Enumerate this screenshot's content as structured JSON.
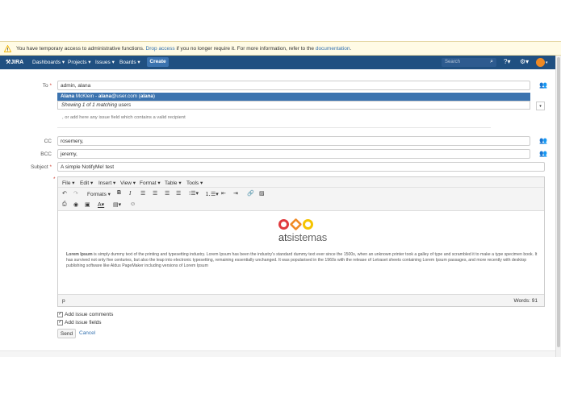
{
  "banner": {
    "text_before": "You have temporary access to administrative functions.",
    "drop_access": "Drop access",
    "text_middle": "if you no longer require it. For more information, refer to the",
    "documentation": "documentation",
    "text_end": ".",
    "icon": "warning-icon"
  },
  "nav": {
    "logo": "JIRA",
    "items": [
      "Dashboards ▾",
      "Projects ▾",
      "Issues ▾",
      "Boards ▾"
    ],
    "create": "Create",
    "search_placeholder": "Search",
    "icons": [
      "search-icon",
      "help-icon",
      "gear-icon",
      "avatar"
    ]
  },
  "form": {
    "to": {
      "label": "To",
      "value": "admin, alana"
    },
    "suggestion": {
      "name_bold": "Alana",
      "name_rest": "McKlein -",
      "email_bold": "alana",
      "email_rest": "@user.com (",
      "user_bold": "alana",
      "close": ")"
    },
    "matching": "Showing 1 of 1 matching users",
    "hint": ", or add here any issue field which contains a valid recipient",
    "cc": {
      "label": "CC",
      "value": "rosemery,"
    },
    "bcc": {
      "label": "BCC",
      "value": "jeremy,"
    },
    "subject": {
      "label": "Subject",
      "value": "A simple NotifyMe! test"
    }
  },
  "editor": {
    "menus": [
      "File ▾",
      "Edit ▾",
      "Insert ▾",
      "View ▾",
      "Format ▾",
      "Table ▾",
      "Tools ▾"
    ],
    "formats": "Formats ▾",
    "bold": "B",
    "italic": "I",
    "logo_text_a": "at",
    "logo_text_b": "sistemas",
    "para_bold": "Lorem Ipsum",
    "para_text": "is simply dummy text of the printing and typesetting industry. Lorem Ipsum has been the industry's standard dummy text ever since the 1500s, when an unknown printer took a galley of type and scrambled it to make a type specimen book. It has survived not only five centuries, but also the leap into electronic typesetting, remaining essentially unchanged. It was popularised in the 1960s with the release of Letraset sheets containing Lorem Ipsum passages, and more recently with desktop publishing software like Aldus PageMaker including versions of Lorem Ipsum",
    "path": "p",
    "words": "Words: 91"
  },
  "options": {
    "comments": "Add issue comments",
    "fields": "Add issue fields"
  },
  "actions": {
    "send": "Send",
    "cancel": "Cancel"
  },
  "colors": {
    "nav": "#205081",
    "accent": "#3b73af",
    "link": "#3572b0",
    "warning": "#f0b400",
    "logo_red": "#e03a3e",
    "logo_orange": "#f08a24",
    "logo_yellow": "#f5c400"
  }
}
